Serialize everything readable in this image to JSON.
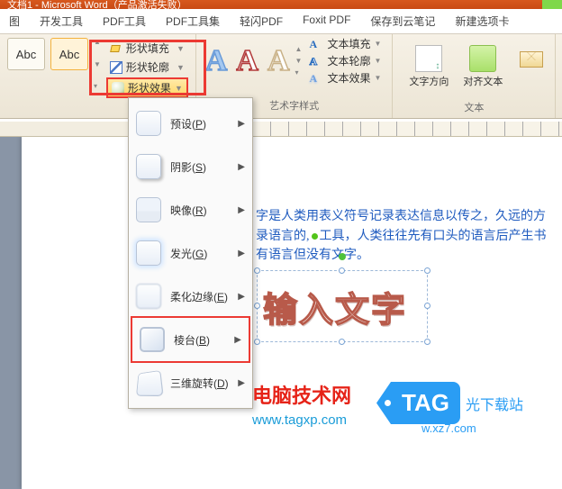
{
  "title": "文档1 - Microsoft Word（产品激活失败）",
  "tabs": [
    "图",
    "开发工具",
    "PDF工具",
    "PDF工具集",
    "轻闪PDF",
    "Foxit PDF",
    "保存到云笔记",
    "新建选项卡"
  ],
  "shape_box_label": "Abc",
  "shape_fill": "形状填充",
  "shape_outline": "形状轮廓",
  "shape_effects": "形状效果",
  "wordart_group": "艺术字样式",
  "text_group": "文本",
  "text_fill": "文本填充",
  "text_outline": "文本轮廓",
  "text_effects": "文本效果",
  "text_direction": "文字方向",
  "align_text": "对齐文本",
  "menu": {
    "preset": "预设(P)",
    "shadow": "阴影(S)",
    "reflection": "映像(R)",
    "glow": "发光(G)",
    "softedge": "柔化边缘(E)",
    "bevel": "棱台(B)",
    "rotation3d": "三维旋转(D)"
  },
  "doc": {
    "line1": "字是人类用表义符号记录表达信息以传之，久远的方",
    "line2": "录语言的",
    "line2b": "工具，人类往往先有口头的语言后产生书",
    "line3": "有语言但没有文字。",
    "wordart": "输入文字"
  },
  "watermark": {
    "title": "电脑技术网",
    "url": "www.tagxp.com",
    "tag": "TAG",
    "site": "光下载站",
    "site_url": "w.xz7.com"
  }
}
